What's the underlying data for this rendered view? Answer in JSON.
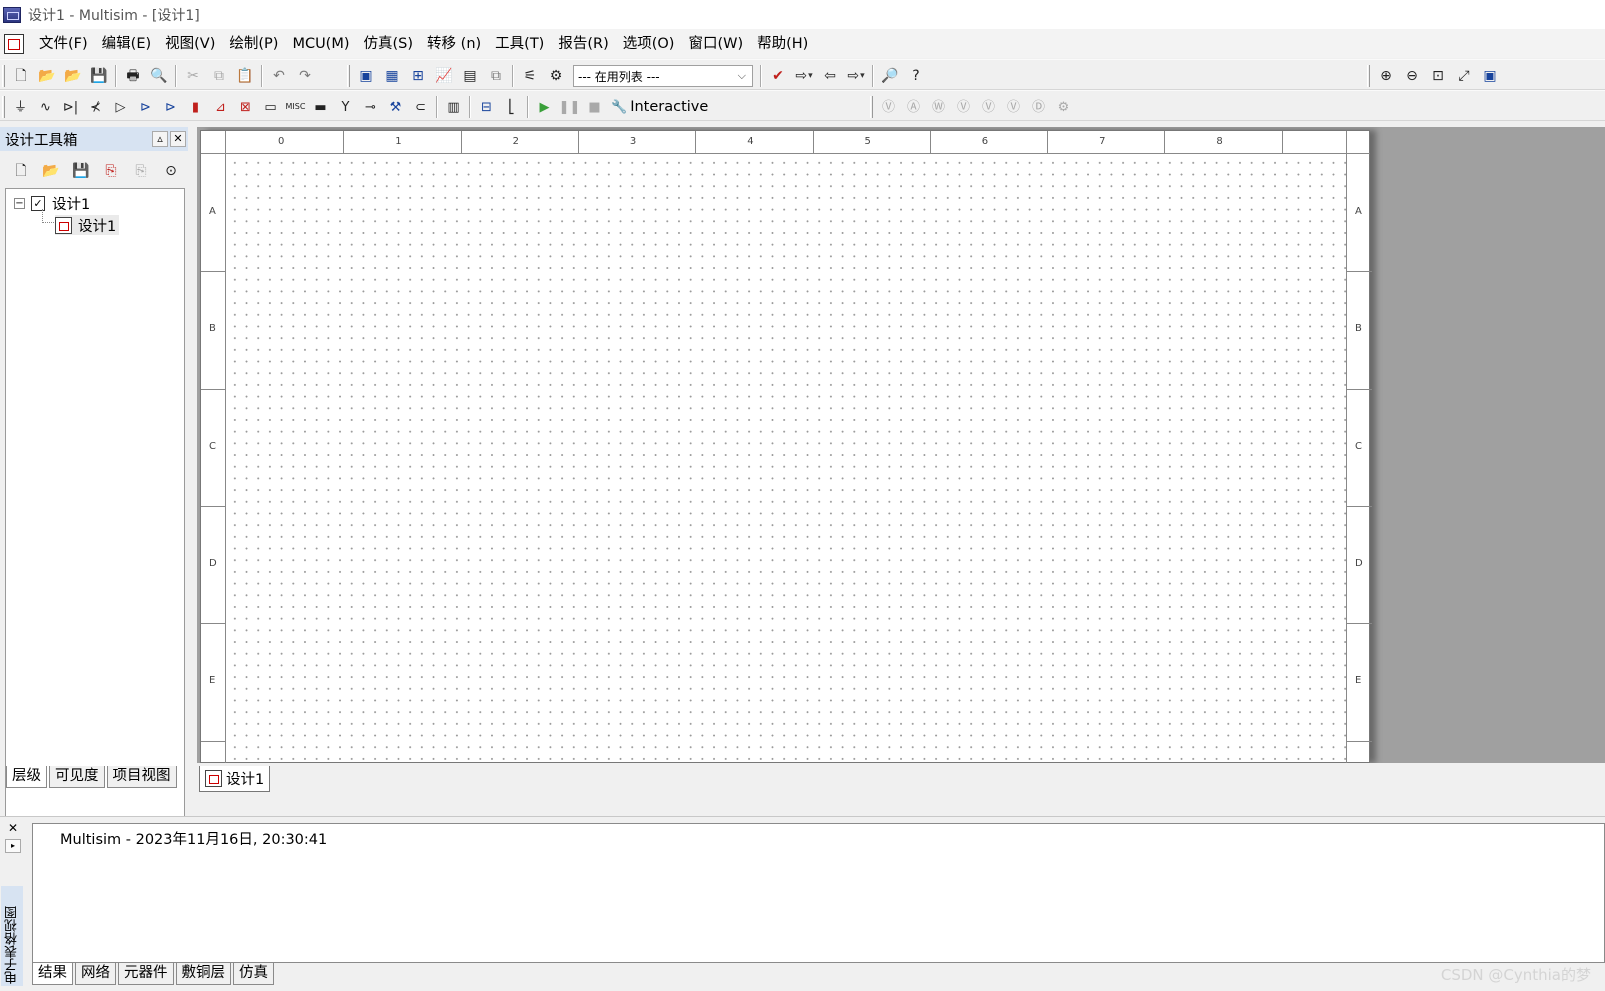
{
  "window": {
    "title": "设计1 - Multisim - [设计1]"
  },
  "menu": [
    "文件(F)",
    "编辑(E)",
    "视图(V)",
    "绘制(P)",
    "MCU(M)",
    "仿真(S)",
    "转移 (n)",
    "工具(T)",
    "报告(R)",
    "选项(O)",
    "窗口(W)",
    "帮助(H)"
  ],
  "toolbar": {
    "in_use_list": "--- 在用列表 ---",
    "interactive_label": "Interactive"
  },
  "toolbox": {
    "title": "设计工具箱",
    "tree": {
      "root": "设计1",
      "child": "设计1"
    },
    "tabs": [
      "层级",
      "可见度",
      "项目视图"
    ]
  },
  "sheet": {
    "tab_label": "设计1",
    "col_labels": [
      "0",
      "1",
      "2",
      "3",
      "4",
      "5",
      "6",
      "7",
      "8"
    ],
    "row_labels": [
      "A",
      "B",
      "C",
      "D",
      "E"
    ]
  },
  "results": {
    "panel_label": "电子表格视图",
    "log_line": "Multisim  -  2023年11月16日, 20:30:41",
    "tabs": [
      "结果",
      "网络",
      "元器件",
      "敷铜层",
      "仿真"
    ]
  },
  "watermark": "CSDN @Cynthia的梦"
}
